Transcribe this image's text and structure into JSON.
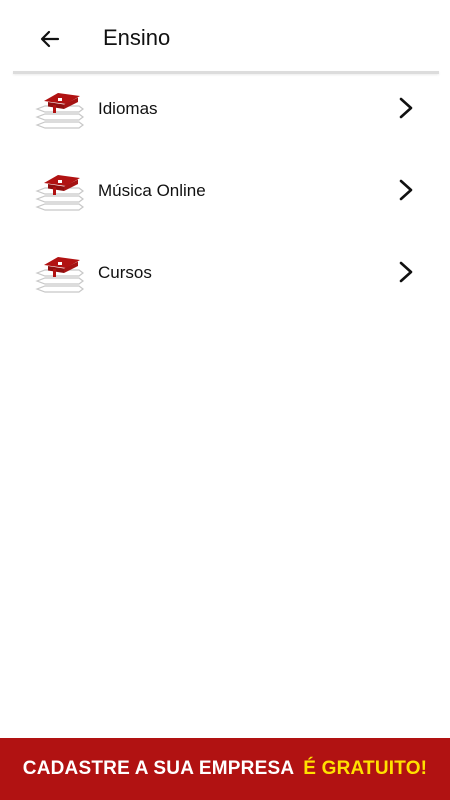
{
  "header": {
    "back_icon": "arrow-left-icon",
    "title": "Ensino"
  },
  "list": {
    "items": [
      {
        "label": "Idiomas",
        "icon": "graduation-books-icon",
        "chevron": "chevron-right-icon"
      },
      {
        "label": "Música Online",
        "icon": "graduation-books-icon",
        "chevron": "chevron-right-icon"
      },
      {
        "label": "Cursos",
        "icon": "graduation-books-icon",
        "chevron": "chevron-right-icon"
      }
    ]
  },
  "banner": {
    "text": "CADASTRE A SUA EMPRESA",
    "highlight": "É GRATUITO!"
  },
  "colors": {
    "accent_red": "#b11212",
    "highlight_yellow": "#ffe100",
    "divider": "#dcdcdc"
  }
}
